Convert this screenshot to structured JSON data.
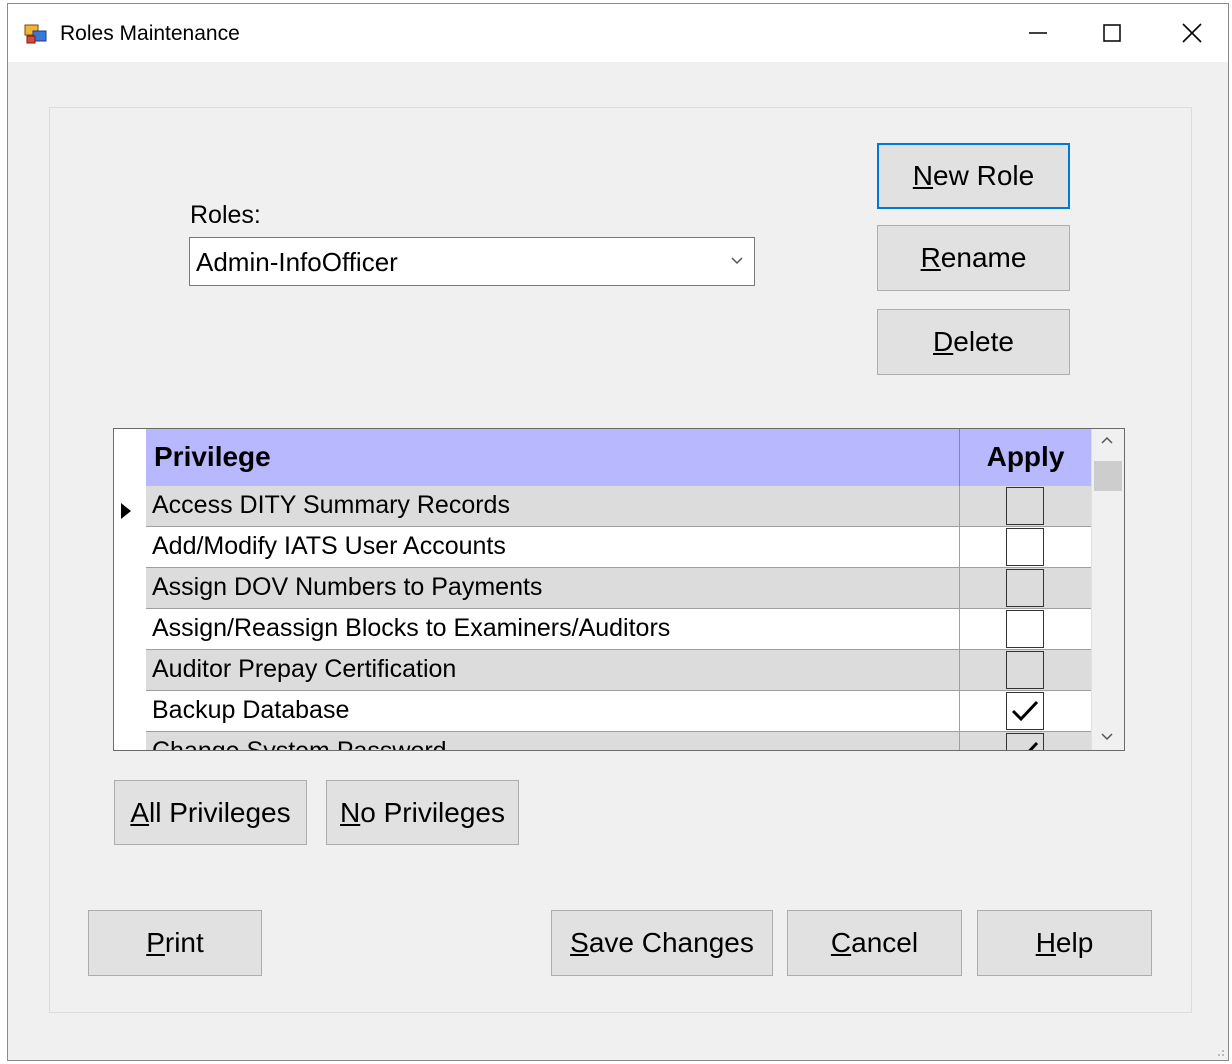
{
  "window": {
    "title": "Roles Maintenance",
    "minimize_glyph": "—",
    "maximize_glyph": "☐",
    "close_glyph": "✕"
  },
  "roles": {
    "label": "Roles:",
    "selected": "Admin-InfoOfficer"
  },
  "buttons": {
    "new_role": {
      "pre": "",
      "key": "N",
      "post": "ew Role"
    },
    "rename": {
      "pre": "",
      "key": "R",
      "post": "ename"
    },
    "delete": {
      "pre": "",
      "key": "D",
      "post": "elete"
    },
    "all_privileges": {
      "pre": "",
      "key": "A",
      "post": "ll Privileges"
    },
    "no_privileges": {
      "pre": "",
      "key": "N",
      "post": "o Privileges"
    },
    "print": {
      "pre": "",
      "key": "P",
      "post": "rint"
    },
    "save_changes": {
      "pre": "",
      "key": "S",
      "post": "ave Changes"
    },
    "cancel": {
      "pre": "",
      "key": "C",
      "post": "ancel"
    },
    "help": {
      "pre": "",
      "key": "H",
      "post": "elp"
    }
  },
  "grid": {
    "columns": {
      "privilege": "Privilege",
      "apply": "Apply"
    },
    "rows": [
      {
        "name": "Access DITY Summary Records",
        "applied": false,
        "current": true
      },
      {
        "name": "Add/Modify IATS User Accounts",
        "applied": false
      },
      {
        "name": "Assign DOV Numbers to Payments",
        "applied": false
      },
      {
        "name": "Assign/Reassign Blocks to Examiners/Auditors",
        "applied": false
      },
      {
        "name": "Auditor Prepay Certification",
        "applied": false
      },
      {
        "name": "Backup Database",
        "applied": true
      },
      {
        "name": "Change System Password",
        "applied": true
      }
    ]
  },
  "colors": {
    "header_bg": "#b8b8ff",
    "alt_row_bg": "#dcdcdc",
    "default_button_border": "#0078d7"
  }
}
